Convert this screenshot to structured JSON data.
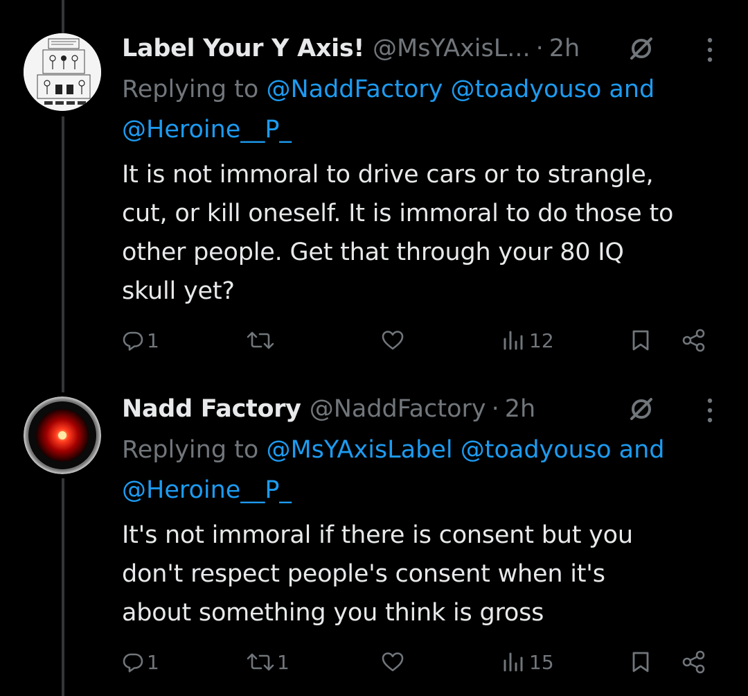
{
  "colors": {
    "background": "#000000",
    "text": "#e7e9ea",
    "muted": "#71767b",
    "link": "#1d9bf0",
    "thread_line": "#333639"
  },
  "tweets": [
    {
      "display_name": "Label Your Y Axis!",
      "handle": "@MsYAxisL...",
      "dot": "·",
      "time": "2h",
      "replying_prefix": "Replying to ",
      "mention_1": "@NaddFactory",
      "mention_2": "@toadyouso",
      "and": " and",
      "mention_3": "@Heroine__P_",
      "body_lines": [
        "It is not immoral to drive cars or to strangle,",
        "cut, or kill oneself. It is immoral to do those to",
        "other people. Get that through your 80 IQ",
        "skull yet?"
      ],
      "reply_count": "1",
      "retweet_count": "",
      "like_count": "",
      "view_count": "12",
      "avatar_icon": "xkcd-comic-avatar"
    },
    {
      "display_name": "Nadd Factory",
      "handle": "@NaddFactory",
      "dot": "·",
      "time": "2h",
      "replying_prefix": "Replying to ",
      "mention_1": "@MsYAxisLabel",
      "mention_2": "@toadyouso",
      "and": " and",
      "mention_3": "@Heroine__P_",
      "body_lines": [
        "It's not immoral if there is consent but you",
        "don't respect people's consent when it's",
        "about something you think is gross"
      ],
      "reply_count": "1",
      "retweet_count": "1",
      "like_count": "",
      "view_count": "15",
      "avatar_icon": "hal9000-red-eye-avatar"
    }
  ]
}
